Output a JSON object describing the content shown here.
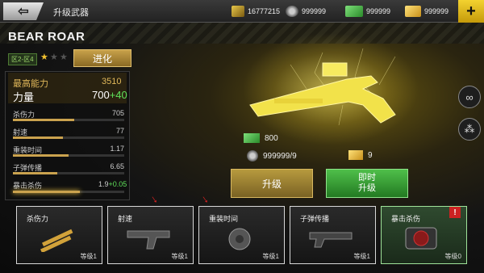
{
  "topbar": {
    "title": "升级武器",
    "resources": [
      {
        "icon": "medal-icon",
        "value": "16777215"
      },
      {
        "icon": "gear-parts-icon",
        "value": "999999"
      },
      {
        "icon": "cash-icon",
        "value": "999999"
      },
      {
        "icon": "gold-bars-icon",
        "value": "999999"
      }
    ],
    "plus_label": "+"
  },
  "weapon": {
    "name": "BEAR ROAR",
    "tier": "区2-区4",
    "stars_filled": 1,
    "stars_total": 3,
    "upgrade_label": "进化"
  },
  "power": {
    "top_label": "最高能力",
    "top_value": "3510",
    "label": "力量",
    "value": "700",
    "bonus": "+40"
  },
  "stats": [
    {
      "label": "杀伤力",
      "value": "705",
      "bonus": "",
      "fill": 0.55
    },
    {
      "label": "射速",
      "value": "77",
      "bonus": "",
      "fill": 0.45
    },
    {
      "label": "重装时间",
      "value": "1.17",
      "bonus": "",
      "fill": 0.5
    },
    {
      "label": "子弹传播",
      "value": "6.65",
      "bonus": "",
      "fill": 0.4
    },
    {
      "label": "暴击杀伤",
      "value": "1.9",
      "bonus": "+0.05",
      "fill": 0.6
    }
  ],
  "costs": {
    "cash": "800",
    "parts": "999999/9",
    "gold": "9"
  },
  "buttons": {
    "upgrade": "升级",
    "instant_line1": "即时",
    "instant_line2": "升级"
  },
  "cards": [
    {
      "name": "杀伤力",
      "level": "等级1"
    },
    {
      "name": "射速",
      "level": "等级1"
    },
    {
      "name": "重装时间",
      "level": "等级1"
    },
    {
      "name": "子弹传播",
      "level": "等级1"
    },
    {
      "name": "暴击杀伤",
      "level": "等级0"
    }
  ],
  "alert": "!",
  "colors": {
    "accent_gold": "#caa24e",
    "bonus_green": "#5fe05a",
    "cash_green": "#3dbb3d"
  }
}
